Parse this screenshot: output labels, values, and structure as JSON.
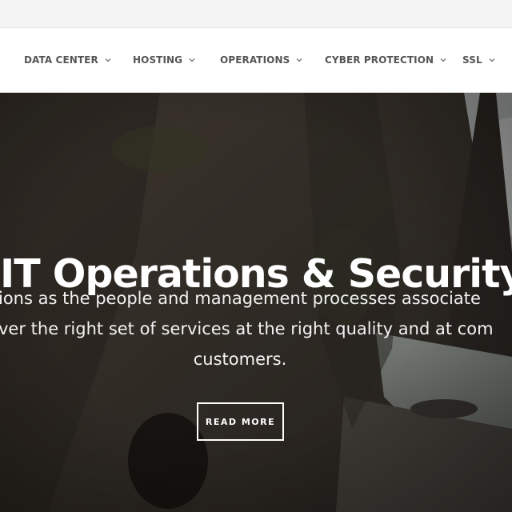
{
  "nav": {
    "items": [
      {
        "label": "DATA CENTER"
      },
      {
        "label": "HOSTING"
      },
      {
        "label": "OPERATIONS"
      },
      {
        "label": "CYBER PROTECTION"
      },
      {
        "label": "SSL"
      }
    ]
  },
  "hero": {
    "title": "IT Operations & Security",
    "description_lines": [
      "ions as the people and management processes associate",
      "ver the right set of services at the right quality and at com",
      "customers."
    ],
    "cta_label": "READ MORE"
  }
}
